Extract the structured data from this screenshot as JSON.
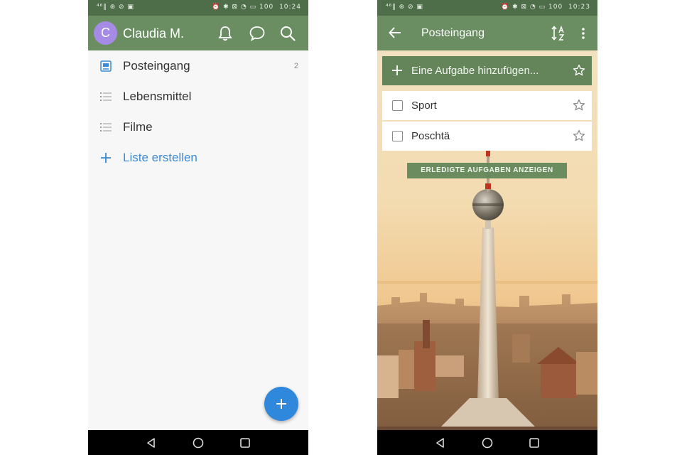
{
  "left_screen": {
    "statusbar": {
      "left_icons": "⁴⁶‖ ⊛ ⊘ ▣",
      "right_icons": "⏰ ✱ ⊠ ◔ ▭",
      "battery": "100",
      "time": "10:24"
    },
    "header": {
      "avatar_letter": "C",
      "username": "Claudia M.",
      "icons": [
        "bell-icon",
        "chat-bubble-icon",
        "search-icon"
      ]
    },
    "lists": [
      {
        "label": "Posteingang",
        "count": "2",
        "icon": "inbox-icon"
      },
      {
        "label": "Lebensmittel",
        "icon": "list-icon"
      },
      {
        "label": "Filme",
        "icon": "list-icon"
      }
    ],
    "create_list": {
      "label": "Liste erstellen",
      "icon": "plus-icon"
    },
    "fab_icon": "plus-icon",
    "colors": {
      "statusbar": "#4d6e48",
      "appbar": "#6a8e62",
      "avatar": "#a58be6",
      "accent": "#2f88dc"
    }
  },
  "right_screen": {
    "statusbar": {
      "left_icons": "⁴⁶‖ ⊛ ⊘ ▣",
      "right_icons": "⏰ ✱ ⊠ ◔ ▭",
      "battery": "100",
      "time": "10:23"
    },
    "header": {
      "title": "Posteingang",
      "icons": [
        "back-arrow-icon",
        "sort-az-icon",
        "more-vert-icon"
      ]
    },
    "add_task_placeholder": "Eine Aufgabe hinzufügen...",
    "tasks": [
      {
        "label": "Sport",
        "starred": false
      },
      {
        "label": "Poschtä",
        "starred": false
      }
    ],
    "show_completed_label": "ERLEDIGTE AUFGABEN ANZEIGEN",
    "background": "Berlin TV tower skyline photo"
  },
  "navbar_icons": [
    "back-triangle-icon",
    "home-circle-icon",
    "recents-square-icon"
  ]
}
